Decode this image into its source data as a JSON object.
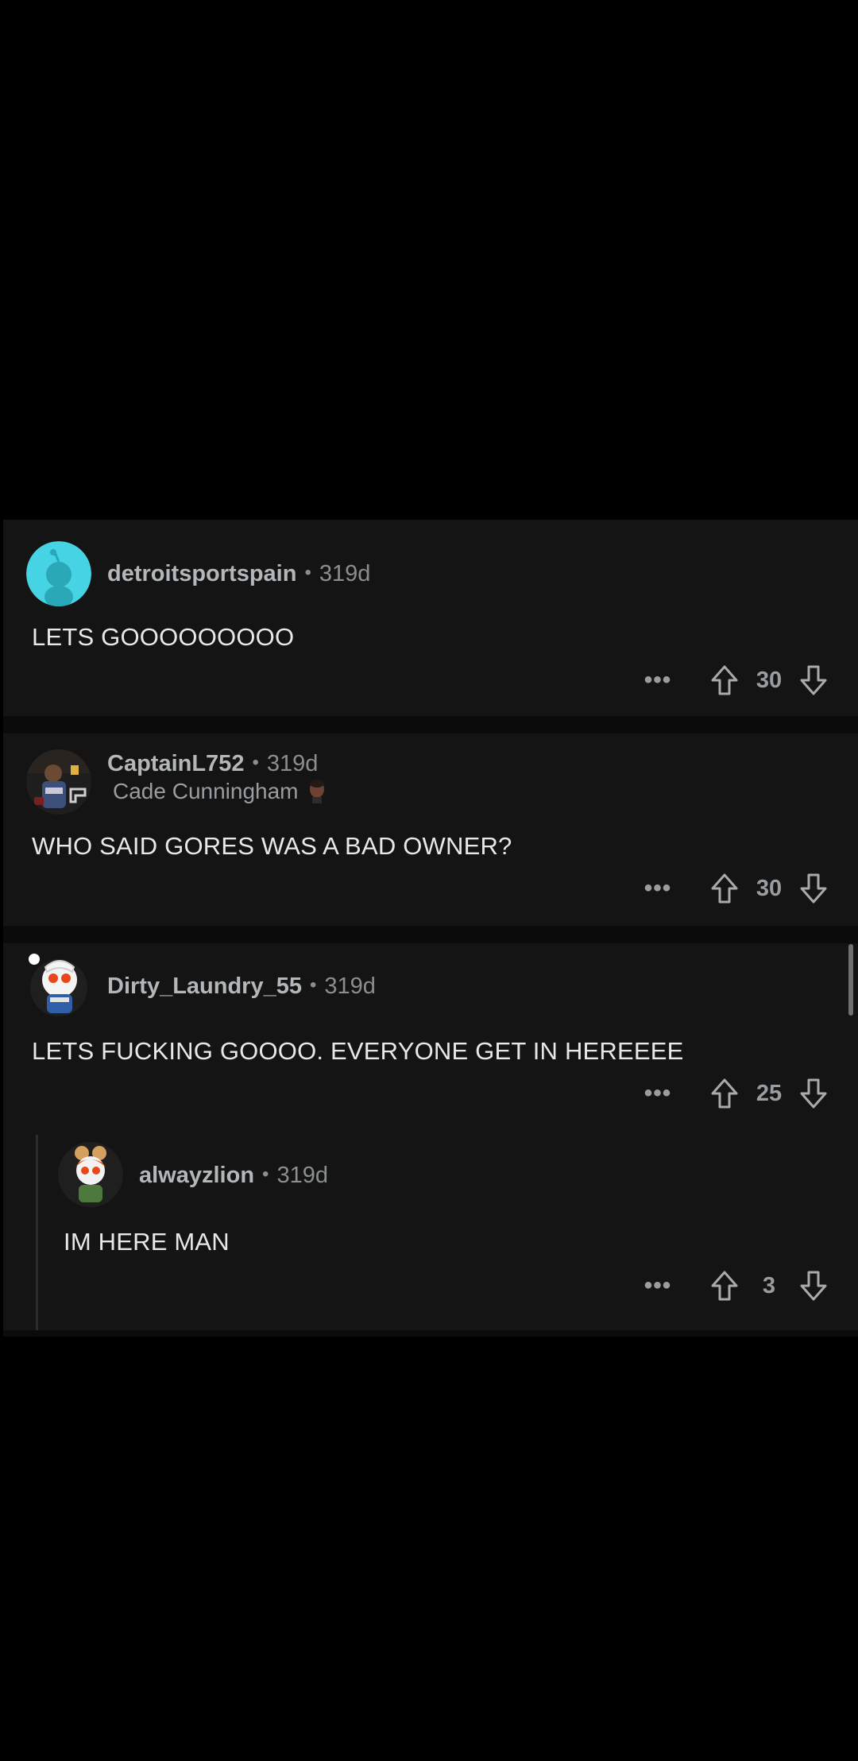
{
  "colors": {
    "background": "#000000",
    "card": "#141414",
    "username": "#b4b7b9",
    "meta": "#8b8e90",
    "body": "#e6e8ea",
    "avatar_teal": "#46d3e3"
  },
  "comments": [
    {
      "username": "detroitsportspain",
      "age": "319d",
      "text": "LETS GOOOOOOOOO",
      "score": "30",
      "avatar_icon": "snoo-default-avatar-icon"
    },
    {
      "username": "CaptainL752",
      "age": "319d",
      "flair": "Cade Cunningham",
      "text": "WHO SAID GORES WAS A BAD OWNER?",
      "score": "30",
      "avatar_icon": "player-photo-avatar-icon"
    },
    {
      "username": "Dirty_Laundry_55",
      "age": "319d",
      "text": "LETS FUCKING GOOOO. EVERYONE GET IN HEREEEE",
      "score": "25",
      "avatar_icon": "snoo-winter-avatar-icon",
      "replies": [
        {
          "username": "alwayzlion",
          "age": "319d",
          "text": "IM HERE MAN",
          "score": "3",
          "avatar_icon": "snoo-redhair-avatar-icon"
        }
      ]
    }
  ],
  "icons": {
    "more": "more-options-icon",
    "upvote": "upvote-arrow-icon",
    "downvote": "downvote-arrow-icon"
  },
  "more_glyph": "•••"
}
